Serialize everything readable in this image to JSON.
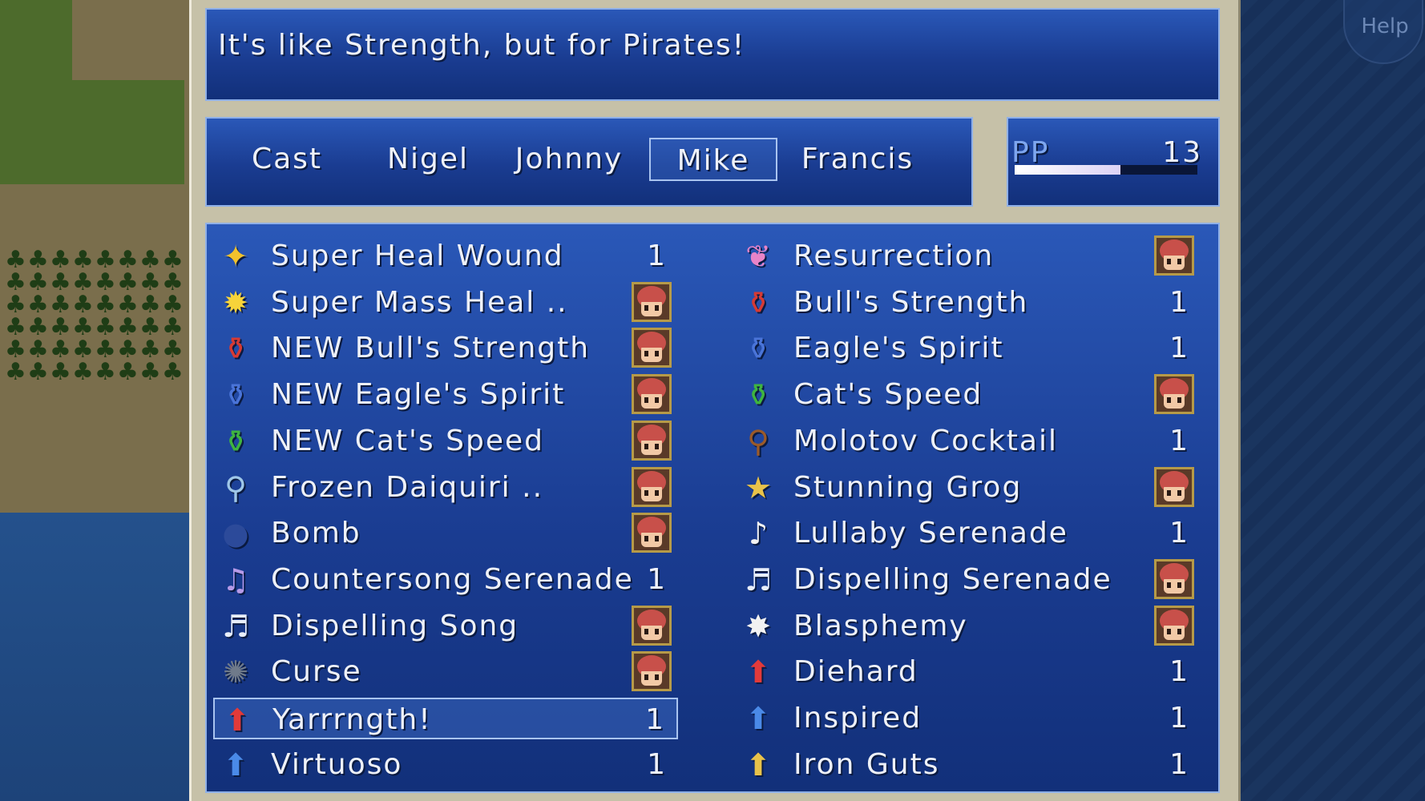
{
  "description": "It's like Strength, but for Pirates!",
  "help_label": "Help",
  "tabs": [
    {
      "label": "Cast",
      "active": false
    },
    {
      "label": "Nigel",
      "active": false
    },
    {
      "label": "Johnny",
      "active": false
    },
    {
      "label": "Mike",
      "active": true
    },
    {
      "label": "Francis",
      "active": false
    }
  ],
  "pp": {
    "label": "PP",
    "value": "13",
    "fraction": 0.58
  },
  "items_left": [
    {
      "name": "Super Heal Wound",
      "qty": "1",
      "icon": "heal-icon",
      "portrait": false
    },
    {
      "name": "Super Mass Heal ..",
      "qty": "",
      "icon": "mass-heal-icon",
      "portrait": true
    },
    {
      "name": "NEW Bull's Strength",
      "qty": "",
      "icon": "red-potion-icon",
      "portrait": true
    },
    {
      "name": "NEW Eagle's Spirit",
      "qty": "",
      "icon": "blue-potion-icon",
      "portrait": true
    },
    {
      "name": "NEW Cat's Speed",
      "qty": "",
      "icon": "green-potion-icon",
      "portrait": true
    },
    {
      "name": "Frozen Daiquiri ..",
      "qty": "",
      "icon": "bottle-icon",
      "portrait": true
    },
    {
      "name": "Bomb",
      "qty": "",
      "icon": "bomb-icon",
      "portrait": true
    },
    {
      "name": "Countersong Serenade",
      "qty": "1",
      "icon": "music-swirl-icon",
      "portrait": false
    },
    {
      "name": "Dispelling Song",
      "qty": "",
      "icon": "dispel-icon",
      "portrait": true
    },
    {
      "name": "Curse",
      "qty": "",
      "icon": "curse-icon",
      "portrait": true
    },
    {
      "name": "Yarrrngth!",
      "qty": "1",
      "icon": "str-up-icon",
      "portrait": false,
      "selected": true
    },
    {
      "name": "Virtuoso",
      "qty": "1",
      "icon": "spi-up-icon",
      "portrait": false
    }
  ],
  "items_right": [
    {
      "name": "Resurrection",
      "qty": "",
      "icon": "resurrection-icon",
      "portrait": true
    },
    {
      "name": "Bull's Strength",
      "qty": "1",
      "icon": "red-potion-icon",
      "portrait": false
    },
    {
      "name": "Eagle's Spirit",
      "qty": "1",
      "icon": "blue-potion-icon",
      "portrait": false
    },
    {
      "name": "Cat's Speed",
      "qty": "",
      "icon": "green-potion-icon",
      "portrait": true
    },
    {
      "name": "Molotov Cocktail",
      "qty": "1",
      "icon": "molotov-icon",
      "portrait": false
    },
    {
      "name": "Stunning Grog",
      "qty": "",
      "icon": "grog-icon",
      "portrait": true
    },
    {
      "name": "Lullaby Serenade",
      "qty": "1",
      "icon": "sleep-icon",
      "portrait": false
    },
    {
      "name": "Dispelling Serenade",
      "qty": "",
      "icon": "dispel-icon",
      "portrait": true
    },
    {
      "name": "Blasphemy",
      "qty": "",
      "icon": "curse-bubble-icon",
      "portrait": true
    },
    {
      "name": "Diehard",
      "qty": "1",
      "icon": "hp-up-icon",
      "portrait": false
    },
    {
      "name": "Inspired",
      "qty": "1",
      "icon": "mp-up-icon",
      "portrait": false
    },
    {
      "name": "Iron Guts",
      "qty": "1",
      "icon": "res-up-icon",
      "portrait": false
    }
  ]
}
